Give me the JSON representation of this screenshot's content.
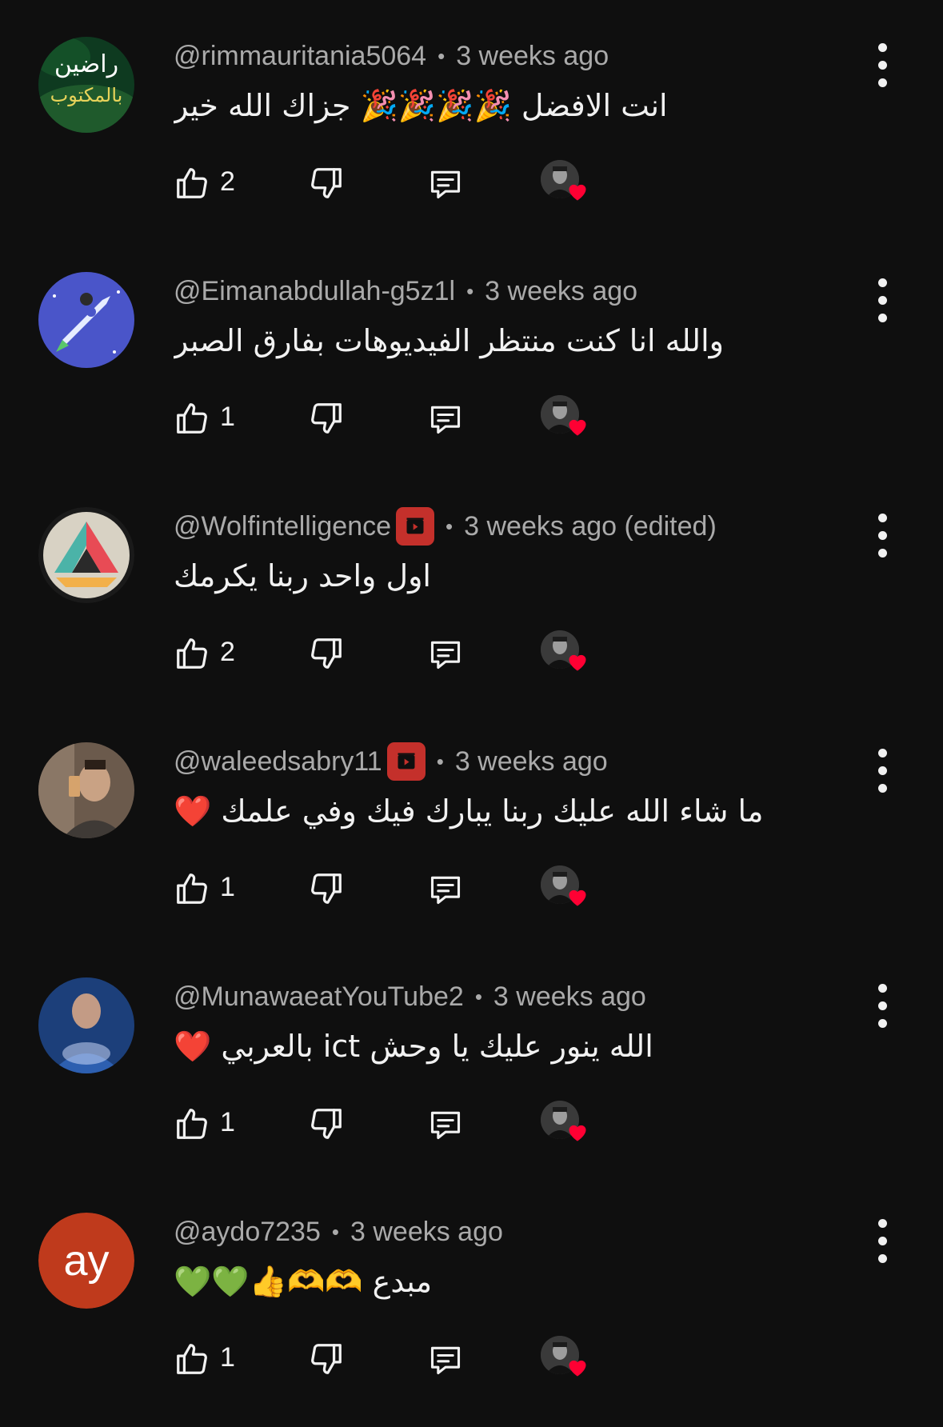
{
  "comments": [
    {
      "handle": "@rimmauritania5064",
      "time": "3 weeks ago",
      "text": "انت الافضل 🎉🎉🎉🎉 جزاك الله خير",
      "likes": "2",
      "creator_badge": false,
      "avatar": {
        "type": "image",
        "bg": "#0e3a20",
        "text_line1": "راضين",
        "text_line2": "بالمكتوب",
        "text_color1": "#ffffff",
        "text_color2": "#e8d35a"
      }
    },
    {
      "handle": "@Eimanabdullah-g5z1l",
      "time": "3 weeks ago",
      "text": "والله انا كنت منتظر الفيديوهات بفارق الصبر",
      "likes": "1",
      "creator_badge": false,
      "avatar": {
        "type": "rocket",
        "bg": "#4a55c9"
      }
    },
    {
      "handle": "@Wolfintelligence",
      "time": "3 weeks ago (edited)",
      "text": "اول واحد ربنا يكرمك",
      "likes": "2",
      "creator_badge": true,
      "avatar": {
        "type": "logo",
        "bg": "#d8d2c4"
      }
    },
    {
      "handle": "@waleedsabry11",
      "time": "3 weeks ago",
      "text": "ما شاء الله عليك ربنا يبارك فيك وفي علمك ❤️",
      "likes": "1",
      "creator_badge": true,
      "avatar": {
        "type": "photo",
        "bg": "#6b5a4c"
      }
    },
    {
      "handle": "@MunawaeatYouTube2",
      "time": "3 weeks ago",
      "text": "الله ينور عليك يا وحش ict بالعربي ❤️",
      "likes": "1",
      "creator_badge": false,
      "avatar": {
        "type": "photo-blue",
        "bg": "#1c3f7a"
      }
    },
    {
      "handle": "@aydo7235",
      "time": "3 weeks ago",
      "text": "مبدع 🫶🫶👍💚💚",
      "likes": "1",
      "creator_badge": false,
      "avatar": {
        "type": "initials",
        "bg": "#bf3a1c",
        "initials": "ay"
      }
    }
  ],
  "icons": {
    "like": "thumbs-up-icon",
    "dislike": "thumbs-down-icon",
    "reply": "reply-icon",
    "menu": "more-vert-icon",
    "creator_heart": "creator-heart-icon",
    "creator_badge": "channel-member-badge-icon"
  },
  "colors": {
    "background": "#0f0f0f",
    "meta_text": "#aaaaaa",
    "primary_text": "#f1f1f1",
    "heart": "#ff0033",
    "badge": "#c4302b"
  }
}
